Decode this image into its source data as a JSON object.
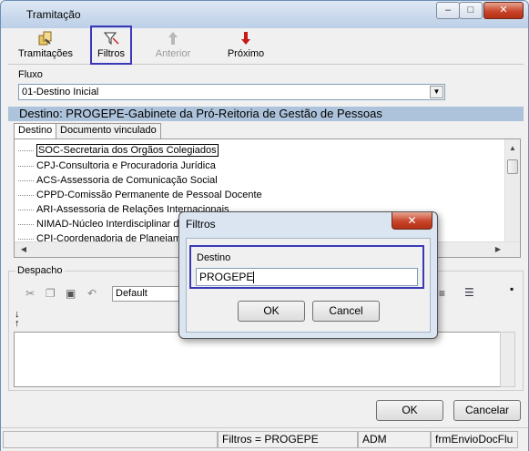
{
  "window": {
    "title": "Tramitação",
    "minimize": "–",
    "maximize": "□",
    "close": "✕"
  },
  "toolbar": {
    "tramitacoes": "Tramitações",
    "filtros": "Filtros",
    "anterior": "Anterior",
    "proximo": "Próximo"
  },
  "fluxo": {
    "label": "Fluxo",
    "value": "01-Destino Inicial"
  },
  "destino_header": "Destino: PROGEPE-Gabinete da Pró-Reitoria de Gestão de Pessoas",
  "tabs": [
    "Destino",
    "Documento vinculado"
  ],
  "tree_items": [
    "SOC-Secretaria dos Orgãos Colegiados",
    "CPJ-Consultoria e Procuradoria Jurídica",
    "ACS-Assessoria de Comunicação Social",
    "CPPD-Comissão Permanente de Pessoal Docente",
    "ARI-Assessoria de Relações Internacionais",
    "NIMAD-Núcleo Interdisciplinar do",
    "CPI-Coordenadoria de Planejamen"
  ],
  "despacho": {
    "label": "Despacho",
    "font": "Default"
  },
  "buttons": {
    "ok": "OK",
    "cancel": "Cancelar"
  },
  "status": {
    "filtros": "Filtros = PROGEPE",
    "user": "ADM",
    "form": "frmEnvioDocFlu"
  },
  "dialog": {
    "title": "Filtros",
    "close": "✕",
    "field_label": "Destino",
    "field_value": "PROGEPE",
    "ok": "OK",
    "cancel": "Cancel"
  }
}
